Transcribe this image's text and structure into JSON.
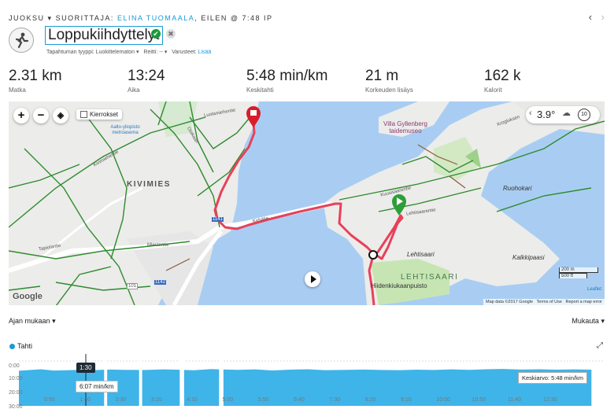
{
  "header": {
    "activity_type": "JUOKSU",
    "performed_by_label": "SUORITTAJA:",
    "athlete": "ELINA TUOMAALA",
    "when": ", EILEN @ 7:48 IP",
    "title": "Loppukiihdyttelyt",
    "event_type_label": "Tapahtuman tyyppi:",
    "event_type_value": "Luokittelematon",
    "route_label": "Reitti:",
    "route_value": "--",
    "gear_label": "Varusteet:",
    "gear_add": "Lisää"
  },
  "stats": [
    {
      "value": "2.31 km",
      "label": "Matka"
    },
    {
      "value": "13:24",
      "label": "Aika"
    },
    {
      "value": "5:48 min/km",
      "label": "Keskitahti"
    },
    {
      "value": "21 m",
      "label": "Korkeuden lisäys"
    },
    {
      "value": "162 k",
      "label": "Kalorit"
    }
  ],
  "map": {
    "laps_label": "Kierrokset",
    "weather_temp": "3.9°",
    "wind_value": "10",
    "labels": {
      "kivimies": "KIVIMIES",
      "lehtisaari_area": "LEHTISAARI",
      "lehtisaari": "Lehtisaari",
      "villa": "Villa Gyllenberg taidemuseo",
      "ruohokari": "Ruohokari",
      "kalkkipaasi": "Kalkkipaasi",
      "hiidenkiukaanpuisto": "Hiidenkiukaanpuisto",
      "metro": "Aalto-yliopisto metroasema",
      "kuusisaarentie": "Kuusisaarentie",
      "lehtisaarentie": "Lehtisaarentie",
      "kehatie": "Kehätie",
      "otakaari": "Otakaari",
      "tapiolantie": "Tapiolantie",
      "miestentie": "Miestentie",
      "luolamiehentie": "Luolamiehentie",
      "kivimiehentie": "Kivimiehentie",
      "kroglukseen": "Krogluksen",
      "road_101": "101",
      "road_1142": "1142",
      "road_1141": "1141"
    },
    "scale_m": "200 m",
    "scale_ft": "500 ft",
    "attribution_leaflet": "Leaflet",
    "attribution_data": "Map data ©2017 Google",
    "terms": "Terms of Use",
    "report": "Report a map error",
    "google": "Google"
  },
  "chart_controls": {
    "sort_label": "Ajan mukaan",
    "customize_label": "Mukauta"
  },
  "chart_data": {
    "type": "area",
    "series": [
      {
        "name": "Tahti"
      }
    ],
    "ytick_labels": [
      "0:00",
      "10:00",
      "20:00",
      "30:00"
    ],
    "ylim": [
      0,
      30
    ],
    "xtick_labels": [
      "0:50",
      "1:40",
      "2:30",
      "3:20",
      "4:10",
      "5:00",
      "5:50",
      "6:40",
      "7:30",
      "8:20",
      "9:10",
      "10:00",
      "10:50",
      "11:40",
      "12:30"
    ],
    "x": [
      0,
      0.5,
      0.8,
      1.3,
      1.7,
      2.1,
      2.4,
      2.9,
      3.3,
      3.6,
      4.0,
      4.4,
      4.6,
      5.0,
      5.4,
      5.8,
      6.2,
      6.6,
      7.0,
      7.5,
      7.9,
      8.3,
      8.7,
      9.1,
      9.5,
      9.9,
      10.3,
      10.7,
      11.1,
      11.5,
      11.9,
      12.3,
      12.7,
      13.1
    ],
    "y": [
      6.5,
      5.5,
      6.4,
      6.0,
      6.1,
      5.7,
      5.9,
      6.0,
      5.6,
      5.8,
      6.2,
      5.4,
      5.6,
      5.9,
      5.6,
      6.3,
      5.8,
      5.5,
      6.1,
      5.9,
      5.7,
      6.0,
      6.1,
      5.8,
      6.0,
      5.6,
      5.9,
      5.5,
      5.3,
      5.7,
      5.5,
      5.8,
      5.6,
      5.8
    ],
    "gaps": [
      [
        1.95,
        2.02
      ],
      [
        2.75,
        2.82
      ],
      [
        3.68,
        3.78
      ],
      [
        4.58,
        4.68
      ]
    ],
    "tooltip_time": "1:30",
    "tooltip_value": "6:07 min/km",
    "average_label": "Keskiarvo: 5:48 min/km",
    "colors": {
      "fill": "#3fb4e8",
      "legend_dot": "#1a9ad6",
      "route": "#e8405a"
    }
  }
}
